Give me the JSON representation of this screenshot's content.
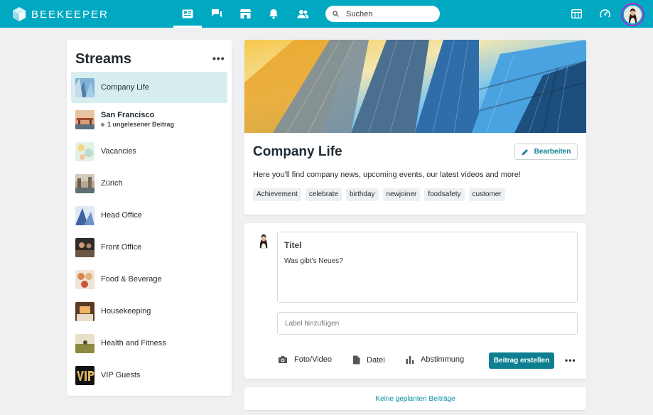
{
  "app": {
    "brand": "BEEKEEPER",
    "accent": "#00a8c2",
    "primary_button": "#0e7f90"
  },
  "topbar": {
    "nav": [
      {
        "name": "news-feed",
        "icon": "newspaper-icon",
        "active": true
      },
      {
        "name": "chats",
        "icon": "chat-bubbles-icon",
        "active": false
      },
      {
        "name": "shop",
        "icon": "store-icon",
        "active": false
      },
      {
        "name": "notifications",
        "icon": "bell-icon",
        "active": false
      },
      {
        "name": "people",
        "icon": "people-icon",
        "active": false
      }
    ],
    "search_placeholder": "Suchen",
    "right_icons": [
      "app-grid-icon",
      "dashboard-gauge-icon"
    ]
  },
  "streams": {
    "title": "Streams",
    "more": "•••",
    "items": [
      {
        "label": "Company Life",
        "active": true,
        "thumb": "#7fb2d6"
      },
      {
        "label": "San Francisco",
        "bold": true,
        "sub": "1 ungelesener Beitrag",
        "thumb": "#c58a62"
      },
      {
        "label": "Vacancies",
        "thumb": "#cfe6d6"
      },
      {
        "label": "Zürich",
        "thumb": "#8c7a68"
      },
      {
        "label": "Head Office",
        "thumb": "#5b7eb5"
      },
      {
        "label": "Front Office",
        "thumb": "#3f3a36"
      },
      {
        "label": "Food & Beverage",
        "thumb": "#c98b5c"
      },
      {
        "label": "Housekeeping",
        "thumb": "#b0703c"
      },
      {
        "label": "Health and Fitness",
        "thumb": "#a39a55"
      },
      {
        "label": "VIP Guests",
        "thumb": "#1a1a1a"
      }
    ]
  },
  "stream_header": {
    "title": "Company Life",
    "edit_label": "Bearbeiten",
    "description": "Here you'll find company news, upcoming events, our latest videos and more!",
    "tags": [
      "Achievement",
      "celebrate",
      "birthday",
      "newjoiner",
      "foodsafety",
      "customer"
    ]
  },
  "composer": {
    "title_placeholder": "Titel",
    "body_placeholder": "Was gibt's Neues?",
    "label_placeholder": "Label hinzufügen",
    "actions": [
      {
        "label": "Foto/Video",
        "icon": "camera-icon"
      },
      {
        "label": "Datei",
        "icon": "file-icon"
      },
      {
        "label": "Abstimmung",
        "icon": "poll-icon"
      }
    ],
    "submit_label": "Beitrag erstellen",
    "more": "•••"
  },
  "scheduled": {
    "label": "Keine geplanten Beiträge"
  }
}
